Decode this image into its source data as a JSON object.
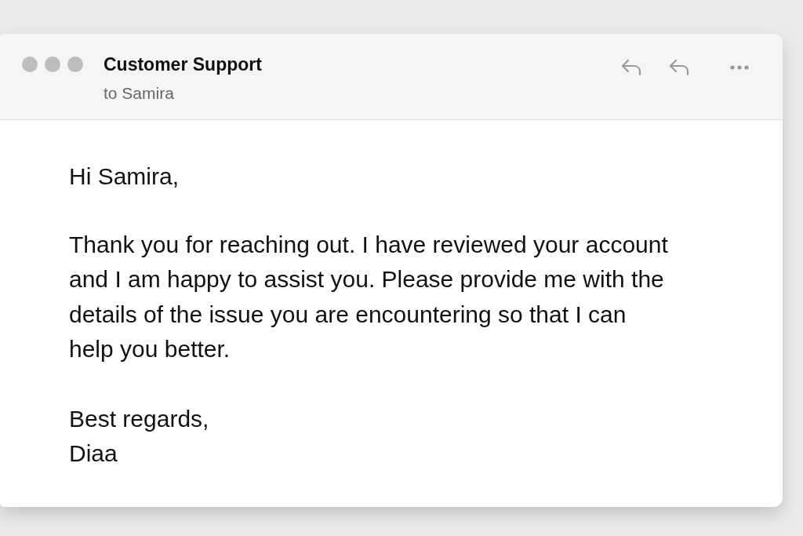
{
  "message": {
    "sender": "Customer Support",
    "recipient": "to Samira"
  },
  "toolbar": [
    {
      "kind": "reply"
    },
    {
      "kind": "reply"
    },
    {
      "kind": "more"
    }
  ],
  "body": {
    "greeting": "Hi Samira,",
    "paragraphs": [
      "Thank you for reaching out. I have reviewed your account and I am happy to assist you. Please provide me with the details of the issue you are encountering so that I can help you better."
    ],
    "closing": "Best regards,",
    "signature": "Diaa"
  }
}
